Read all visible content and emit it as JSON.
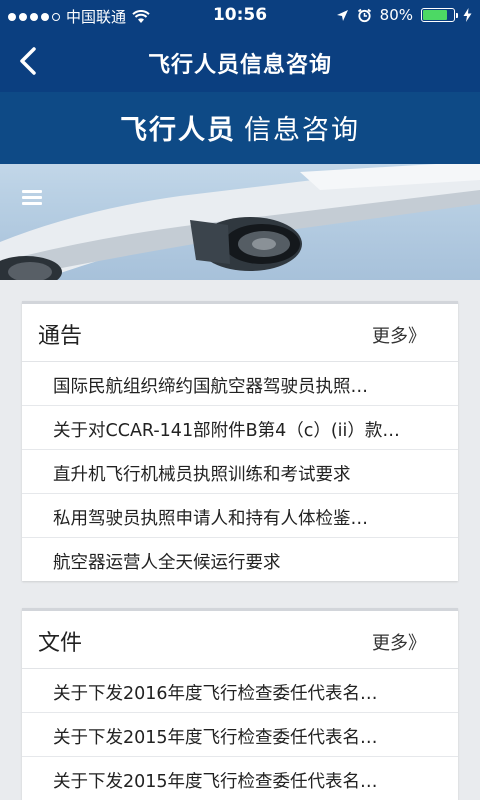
{
  "status_bar": {
    "carrier": "中国联通",
    "time": "10:56",
    "battery": "80%",
    "battery_level": 0.8
  },
  "nav": {
    "title": "飞行人员信息咨询"
  },
  "hero": {
    "title_bold": "飞行人员",
    "title_light": "信息咨询"
  },
  "notices": {
    "title": "通告",
    "more": "更多》",
    "items": [
      "国际民航组织缔约国航空器驾驶员执照…",
      "关于对CCAR-141部附件B第4（c）(ii）款…",
      "直升机飞行机械员执照训练和考试要求",
      "私用驾驶员执照申请人和持有人体检鉴…",
      "航空器运营人全天候运行要求"
    ]
  },
  "documents": {
    "title": "文件",
    "more": "更多》",
    "items": [
      "关于下发2016年度飞行检查委任代表名…",
      "关于下发2015年度飞行检查委任代表名…",
      "关于下发2015年度飞行检查委任代表名…"
    ]
  },
  "colors": {
    "nav_blue": "#0b3f80",
    "hero_band": "#0e4a86",
    "battery_green": "#4cd964"
  }
}
